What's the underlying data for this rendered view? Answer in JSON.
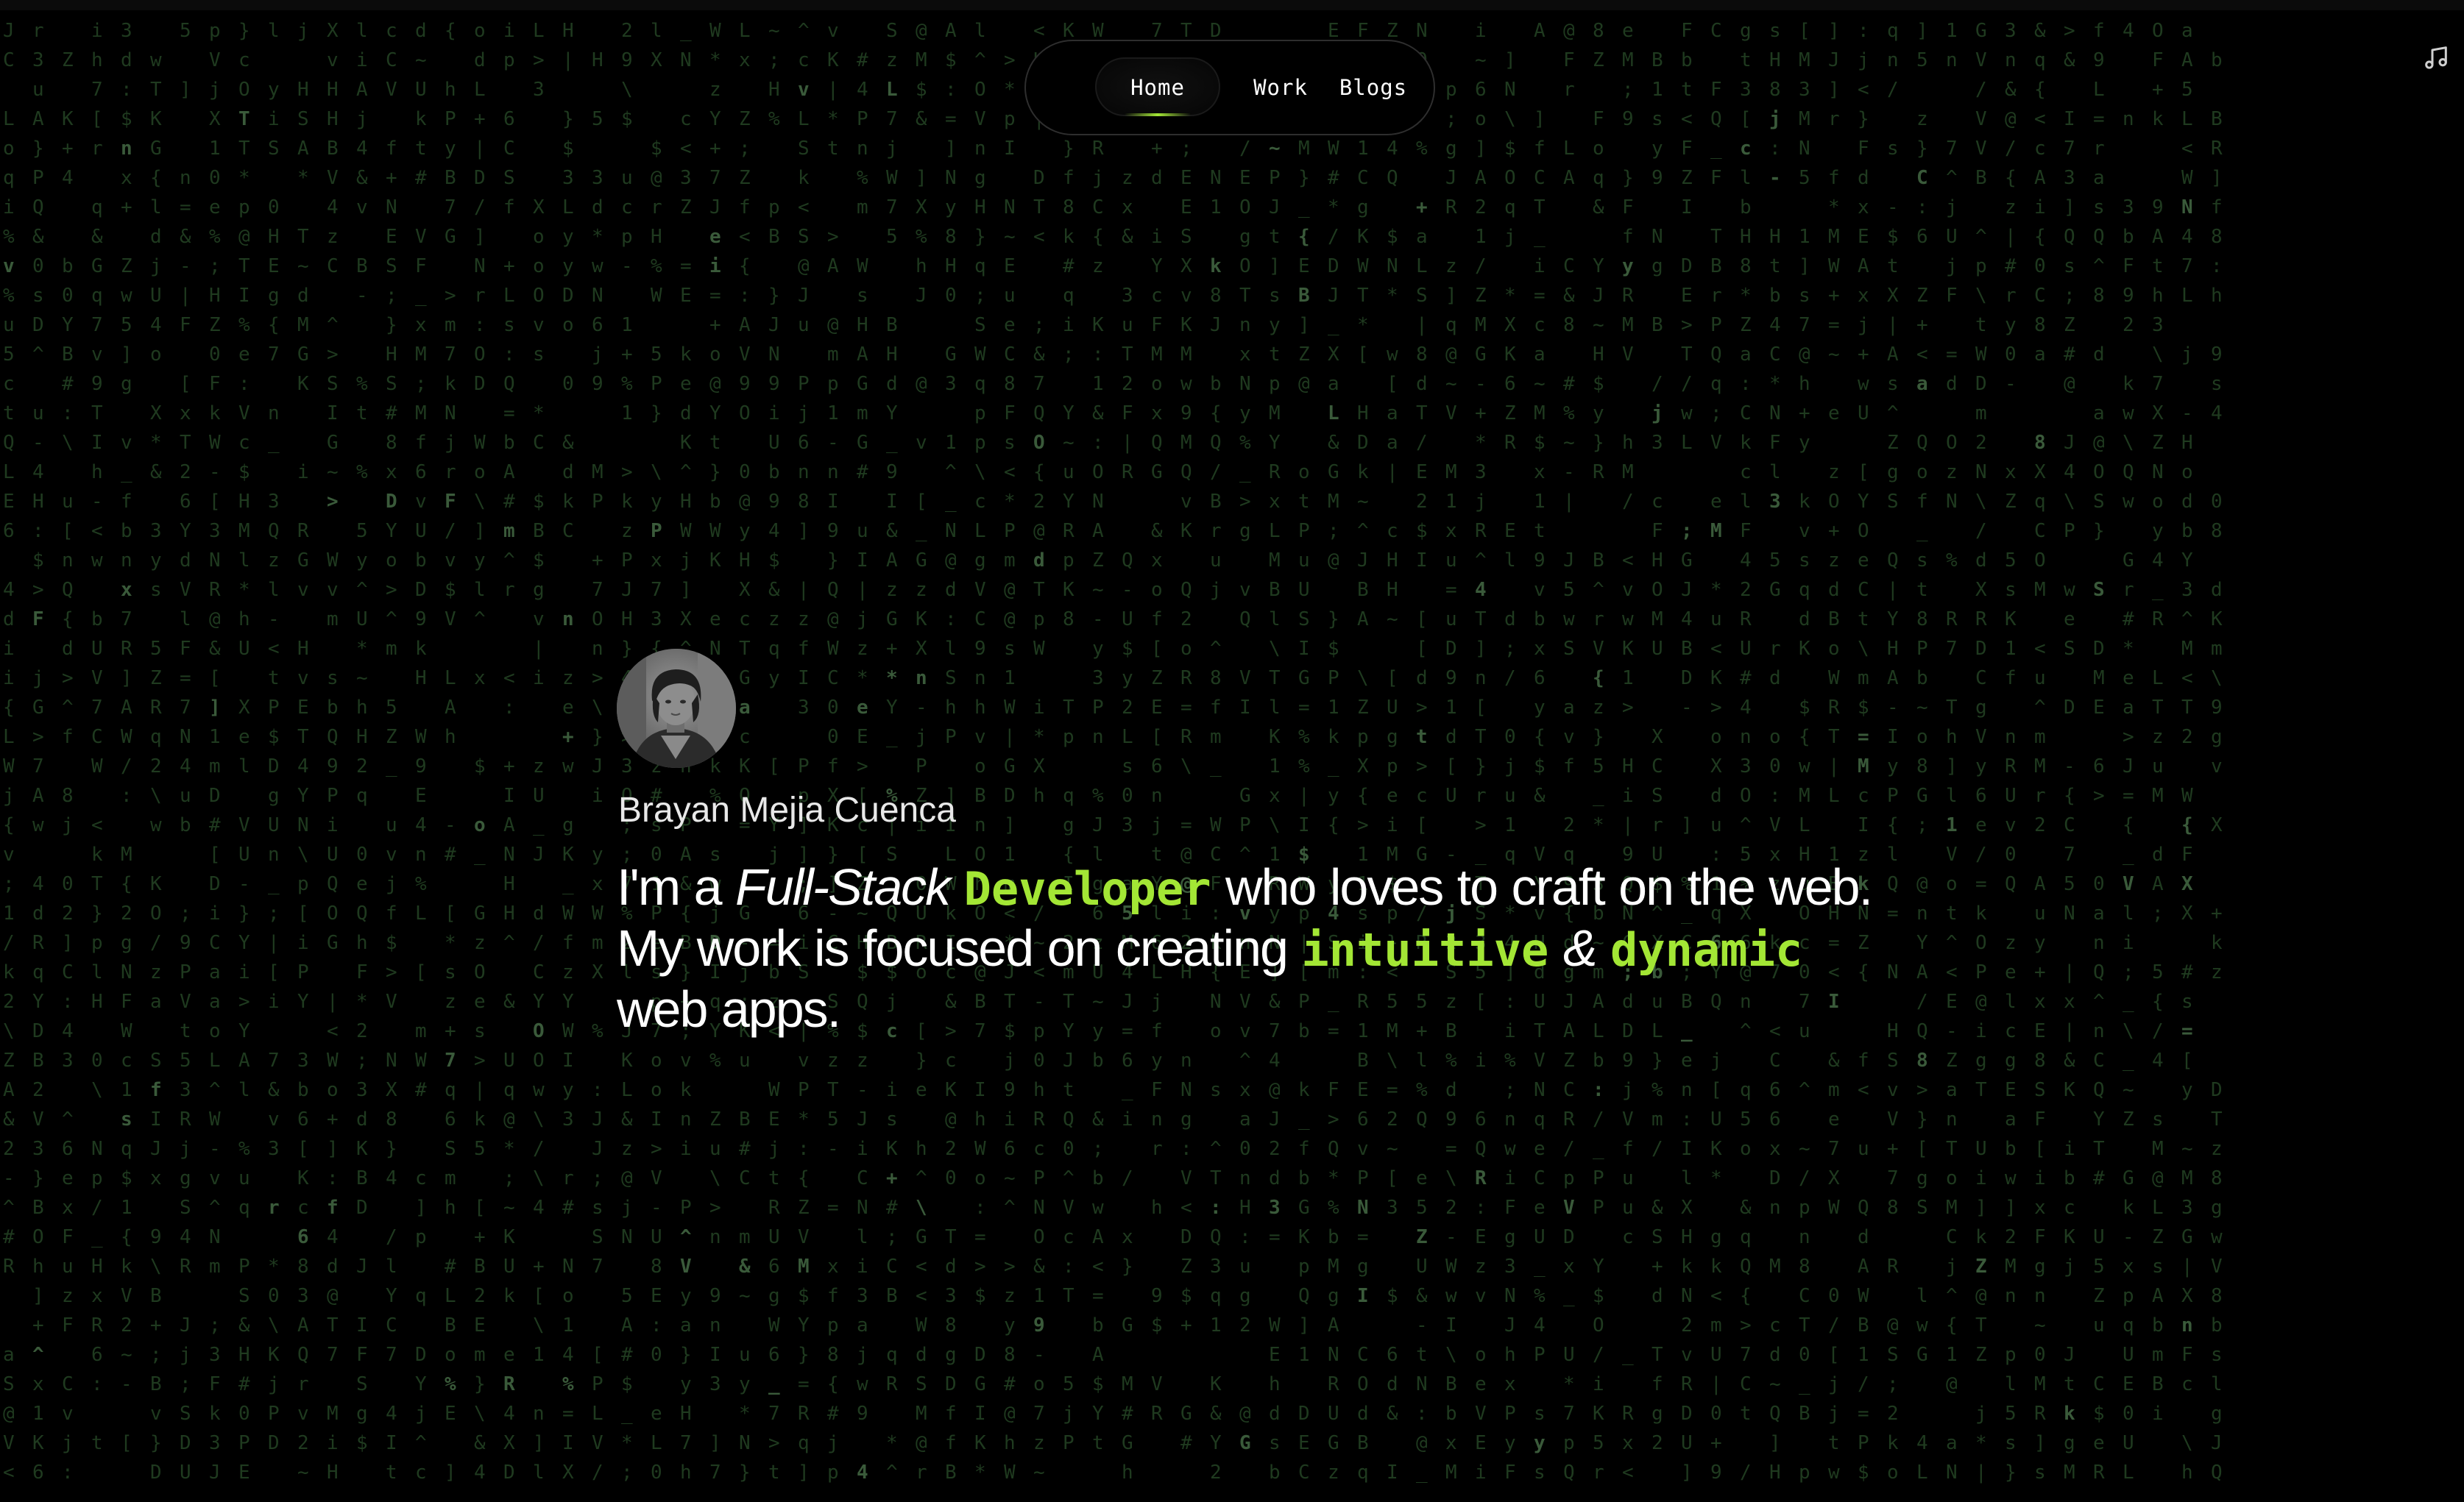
{
  "nav": {
    "items": [
      {
        "label": "Home",
        "active": true
      },
      {
        "label": "Work",
        "active": false
      },
      {
        "label": "Blogs",
        "active": false
      }
    ]
  },
  "top_right": {
    "icon": "music-note-icon"
  },
  "hero": {
    "name": "Brayan Mejia Cuenca",
    "bio": {
      "part1": "I'm a",
      "role_italic": "Full-Stack",
      "role_highlight": "Developer",
      "part2": "who loves to craft on the web. My work is focused on creating",
      "highlight1": "intuitive",
      "amp": "&",
      "highlight2": "dynamic",
      "part3": "web apps."
    }
  },
  "colors": {
    "background": "#000000",
    "accent": "#a3e635",
    "matrix_char": "#1f3a1f",
    "text": "#ffffff"
  }
}
